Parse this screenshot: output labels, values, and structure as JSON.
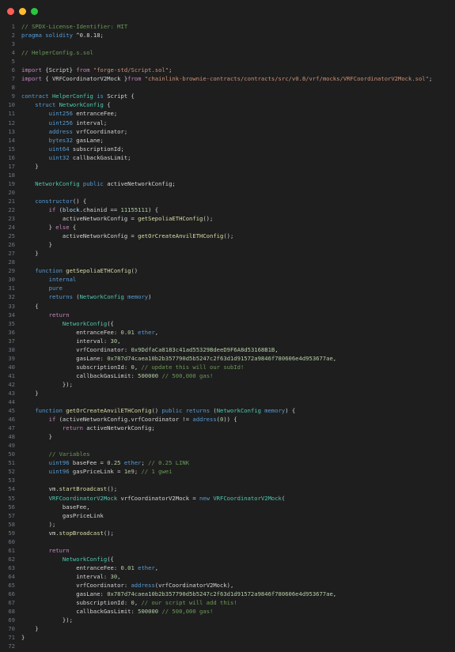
{
  "window": {
    "controls": [
      "close",
      "minimize",
      "maximize"
    ],
    "colors": {
      "close": "#ff5f57",
      "minimize": "#febc2e",
      "maximize": "#28c840",
      "background": "#1e1e1e"
    }
  },
  "editor": {
    "language": "solidity",
    "lines": [
      [
        [
          "// SPDX-License-Identifier: MIT",
          "comment"
        ]
      ],
      [
        [
          "pragma ",
          "keyword"
        ],
        [
          "solidity ",
          "keyword"
        ],
        [
          "^0.8.18;",
          "text"
        ]
      ],
      [],
      [
        [
          "// HelperConfig.s.sol",
          "comment"
        ]
      ],
      [],
      [
        [
          "import ",
          "control"
        ],
        [
          "{Script} ",
          "text"
        ],
        [
          "from ",
          "control"
        ],
        [
          "\"forge-std/Script.sol\"",
          "string"
        ],
        [
          ";",
          "text"
        ]
      ],
      [
        [
          "import ",
          "control"
        ],
        [
          "{ VRFCoordinatorV2Mock }",
          "text"
        ],
        [
          "from ",
          "control"
        ],
        [
          "\"chainlink-brownie-contracts/contracts/src/v0.8/vrf/mocks/VRFCoordinatorV2Mock.sol\"",
          "string"
        ],
        [
          ";",
          "text"
        ]
      ],
      [],
      [
        [
          "contract ",
          "keyword"
        ],
        [
          "HelperConfig ",
          "type"
        ],
        [
          "is ",
          "keyword"
        ],
        [
          "Script {",
          "text"
        ]
      ],
      [
        [
          "    struct ",
          "keyword"
        ],
        [
          "NetworkConfig ",
          "type"
        ],
        [
          "{",
          "text"
        ]
      ],
      [
        [
          "        uint256 ",
          "keyword"
        ],
        [
          "entranceFee;",
          "text"
        ]
      ],
      [
        [
          "        uint256 ",
          "keyword"
        ],
        [
          "interval;",
          "text"
        ]
      ],
      [
        [
          "        address ",
          "keyword"
        ],
        [
          "vrfCoordinator;",
          "text"
        ]
      ],
      [
        [
          "        bytes32 ",
          "keyword"
        ],
        [
          "gasLane;",
          "text"
        ]
      ],
      [
        [
          "        uint64 ",
          "keyword"
        ],
        [
          "subscriptionId;",
          "text"
        ]
      ],
      [
        [
          "        uint32 ",
          "keyword"
        ],
        [
          "callbackGasLimit;",
          "text"
        ]
      ],
      [
        [
          "    }",
          "text"
        ]
      ],
      [],
      [
        [
          "    NetworkConfig ",
          "type"
        ],
        [
          "public ",
          "keyword"
        ],
        [
          "activeNetworkConfig;",
          "text"
        ]
      ],
      [],
      [
        [
          "    constructor",
          "keyword"
        ],
        [
          "() {",
          "text"
        ]
      ],
      [
        [
          "        if ",
          "control"
        ],
        [
          "(",
          "text"
        ],
        [
          "block",
          "var"
        ],
        [
          ".chainid == ",
          "text"
        ],
        [
          "11155111",
          "number"
        ],
        [
          ") {",
          "text"
        ]
      ],
      [
        [
          "            activeNetworkConfig = ",
          "text"
        ],
        [
          "getSepoliaETHConfig",
          "func"
        ],
        [
          "();",
          "text"
        ]
      ],
      [
        [
          "        } ",
          "text"
        ],
        [
          "else ",
          "control"
        ],
        [
          "{",
          "text"
        ]
      ],
      [
        [
          "            activeNetworkConfig = ",
          "text"
        ],
        [
          "getOrCreateAnvilETHConfig",
          "func"
        ],
        [
          "();",
          "text"
        ]
      ],
      [
        [
          "        }",
          "text"
        ]
      ],
      [
        [
          "    }",
          "text"
        ]
      ],
      [],
      [
        [
          "    function ",
          "keyword"
        ],
        [
          "getSepoliaETHConfig",
          "func"
        ],
        [
          "()",
          "text"
        ]
      ],
      [
        [
          "        internal",
          "keyword"
        ]
      ],
      [
        [
          "        pure",
          "keyword"
        ]
      ],
      [
        [
          "        returns ",
          "keyword"
        ],
        [
          "(",
          "text"
        ],
        [
          "NetworkConfig ",
          "type"
        ],
        [
          "memory",
          "keyword"
        ],
        [
          ")",
          "text"
        ]
      ],
      [
        [
          "    {",
          "text"
        ]
      ],
      [
        [
          "        return",
          "control"
        ]
      ],
      [
        [
          "            NetworkConfig",
          "type"
        ],
        [
          "({",
          "text"
        ]
      ],
      [
        [
          "                entranceFee: ",
          "text"
        ],
        [
          "0.01 ",
          "number"
        ],
        [
          "ether",
          "keyword"
        ],
        [
          ",",
          "text"
        ]
      ],
      [
        [
          "                interval: ",
          "text"
        ],
        [
          "30",
          "number"
        ],
        [
          ",",
          "text"
        ]
      ],
      [
        [
          "                vrfCoordinator: ",
          "text"
        ],
        [
          "0x9DdfaCa8183c41ad55329BdeeD9F6A8d53168B1B",
          "number"
        ],
        [
          ",",
          "text"
        ]
      ],
      [
        [
          "                gasLane: ",
          "text"
        ],
        [
          "0x787d74caea10b2b357790d5b5247c2f63d1d91572a9846f780606e4d953677ae",
          "number"
        ],
        [
          ",",
          "text"
        ]
      ],
      [
        [
          "                subscriptionId: ",
          "text"
        ],
        [
          "0",
          "number"
        ],
        [
          ", ",
          "text"
        ],
        [
          "// update this will our subId!",
          "comment"
        ]
      ],
      [
        [
          "                callbackGasLimit: ",
          "text"
        ],
        [
          "500000 ",
          "number"
        ],
        [
          "// 500,000 gas!",
          "comment"
        ]
      ],
      [
        [
          "            });",
          "text"
        ]
      ],
      [
        [
          "    }",
          "text"
        ]
      ],
      [],
      [
        [
          "    function ",
          "keyword"
        ],
        [
          "getOrCreateAnvilETHConfig",
          "func"
        ],
        [
          "() ",
          "text"
        ],
        [
          "public ",
          "keyword"
        ],
        [
          "returns ",
          "keyword"
        ],
        [
          "(",
          "text"
        ],
        [
          "NetworkConfig ",
          "type"
        ],
        [
          "memory",
          "keyword"
        ],
        [
          ") {",
          "text"
        ]
      ],
      [
        [
          "        if ",
          "control"
        ],
        [
          "(activeNetworkConfig.vrfCoordinator != ",
          "text"
        ],
        [
          "address",
          "keyword"
        ],
        [
          "(",
          "text"
        ],
        [
          "0",
          "number"
        ],
        [
          ")) {",
          "text"
        ]
      ],
      [
        [
          "            return ",
          "control"
        ],
        [
          "activeNetworkConfig;",
          "text"
        ]
      ],
      [
        [
          "        }",
          "text"
        ]
      ],
      [],
      [
        [
          "        // Variables",
          "comment"
        ]
      ],
      [
        [
          "        uint96 ",
          "keyword"
        ],
        [
          "baseFee = ",
          "text"
        ],
        [
          "0.25 ",
          "number"
        ],
        [
          "ether",
          "keyword"
        ],
        [
          "; ",
          "text"
        ],
        [
          "// 0.25 LINK",
          "comment"
        ]
      ],
      [
        [
          "        uint96 ",
          "keyword"
        ],
        [
          "gasPriceLink = ",
          "text"
        ],
        [
          "1e9",
          "number"
        ],
        [
          "; ",
          "text"
        ],
        [
          "// 1 gwei",
          "comment"
        ]
      ],
      [],
      [
        [
          "        vm.",
          "text"
        ],
        [
          "startBroadcast",
          "func"
        ],
        [
          "();",
          "text"
        ]
      ],
      [
        [
          "        VRFCoordinatorV2Mock ",
          "type"
        ],
        [
          "vrfCoordinatorV2Mock = ",
          "text"
        ],
        [
          "new ",
          "keyword"
        ],
        [
          "VRFCoordinatorV2Mock",
          "type"
        ],
        [
          "(",
          "text"
        ]
      ],
      [
        [
          "            baseFee,",
          "text"
        ]
      ],
      [
        [
          "            gasPriceLink",
          "text"
        ]
      ],
      [
        [
          "        );",
          "text"
        ]
      ],
      [
        [
          "        vm.",
          "text"
        ],
        [
          "stopBroadcast",
          "func"
        ],
        [
          "();",
          "text"
        ]
      ],
      [],
      [
        [
          "        return",
          "control"
        ]
      ],
      [
        [
          "            NetworkConfig",
          "type"
        ],
        [
          "({",
          "text"
        ]
      ],
      [
        [
          "                entranceFee: ",
          "text"
        ],
        [
          "0.01 ",
          "number"
        ],
        [
          "ether",
          "keyword"
        ],
        [
          ",",
          "text"
        ]
      ],
      [
        [
          "                interval: ",
          "text"
        ],
        [
          "30",
          "number"
        ],
        [
          ",",
          "text"
        ]
      ],
      [
        [
          "                vrfCoordinator: ",
          "text"
        ],
        [
          "address",
          "keyword"
        ],
        [
          "(vrfCoordinatorV2Mock),",
          "text"
        ]
      ],
      [
        [
          "                gasLane: ",
          "text"
        ],
        [
          "0x787d74caea10b2b357790d5b5247c2f63d1d91572a9846f780606e4d953677ae",
          "number"
        ],
        [
          ",",
          "text"
        ]
      ],
      [
        [
          "                subscriptionId: ",
          "text"
        ],
        [
          "0",
          "number"
        ],
        [
          ", ",
          "text"
        ],
        [
          "// our script will add this!",
          "comment"
        ]
      ],
      [
        [
          "                callbackGasLimit: ",
          "text"
        ],
        [
          "500000 ",
          "number"
        ],
        [
          "// 500,000 gas!",
          "comment"
        ]
      ],
      [
        [
          "            });",
          "text"
        ]
      ],
      [
        [
          "    }",
          "text"
        ]
      ],
      [
        [
          "}",
          "text"
        ]
      ],
      []
    ]
  }
}
